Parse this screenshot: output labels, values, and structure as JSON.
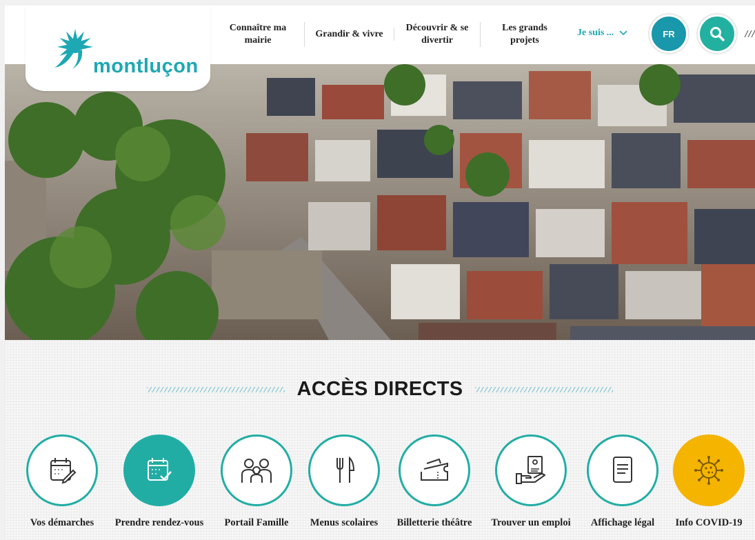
{
  "brand": {
    "logo_text": "montluçon",
    "logo_color": "#1ea8b3"
  },
  "nav": {
    "items": [
      {
        "label_line1": "Connaître ma",
        "label_line2": "mairie"
      },
      {
        "label_line1": "Grandir & vivre",
        "label_line2": ""
      },
      {
        "label_line1": "Découvrir & se",
        "label_line2": "divertir"
      },
      {
        "label_line1": "Les grands projets",
        "label_line2": ""
      }
    ],
    "je_suis": "Je suis ...",
    "language": "FR",
    "search_icon": "search-icon"
  },
  "hero": {
    "image": "aerial-view-of-old-town-icon"
  },
  "acces_directs": {
    "title": "ACCÈS DIRECTS",
    "items": [
      {
        "label": "Vos démarches",
        "icon": "calendar-pencil-icon",
        "style": "outline"
      },
      {
        "label": "Prendre rendez-vous",
        "icon": "calendar-check-icon",
        "style": "filled"
      },
      {
        "label": "Portail Famille",
        "icon": "family-icon",
        "style": "outline"
      },
      {
        "label": "Menus scolaires",
        "icon": "fork-knife-icon",
        "style": "outline"
      },
      {
        "label": "Billetterie théâtre",
        "icon": "ticket-icon",
        "style": "outline"
      },
      {
        "label": "Trouver un emploi",
        "icon": "job-resume-icon",
        "style": "outline"
      },
      {
        "label": "Affichage légal",
        "icon": "document-icon",
        "style": "outline"
      },
      {
        "label": "Info COVID-19",
        "icon": "virus-icon",
        "style": "covid"
      }
    ]
  },
  "colors": {
    "teal": "#22ada4",
    "lang_blue": "#1898aa",
    "covid_yellow": "#f5b400"
  }
}
